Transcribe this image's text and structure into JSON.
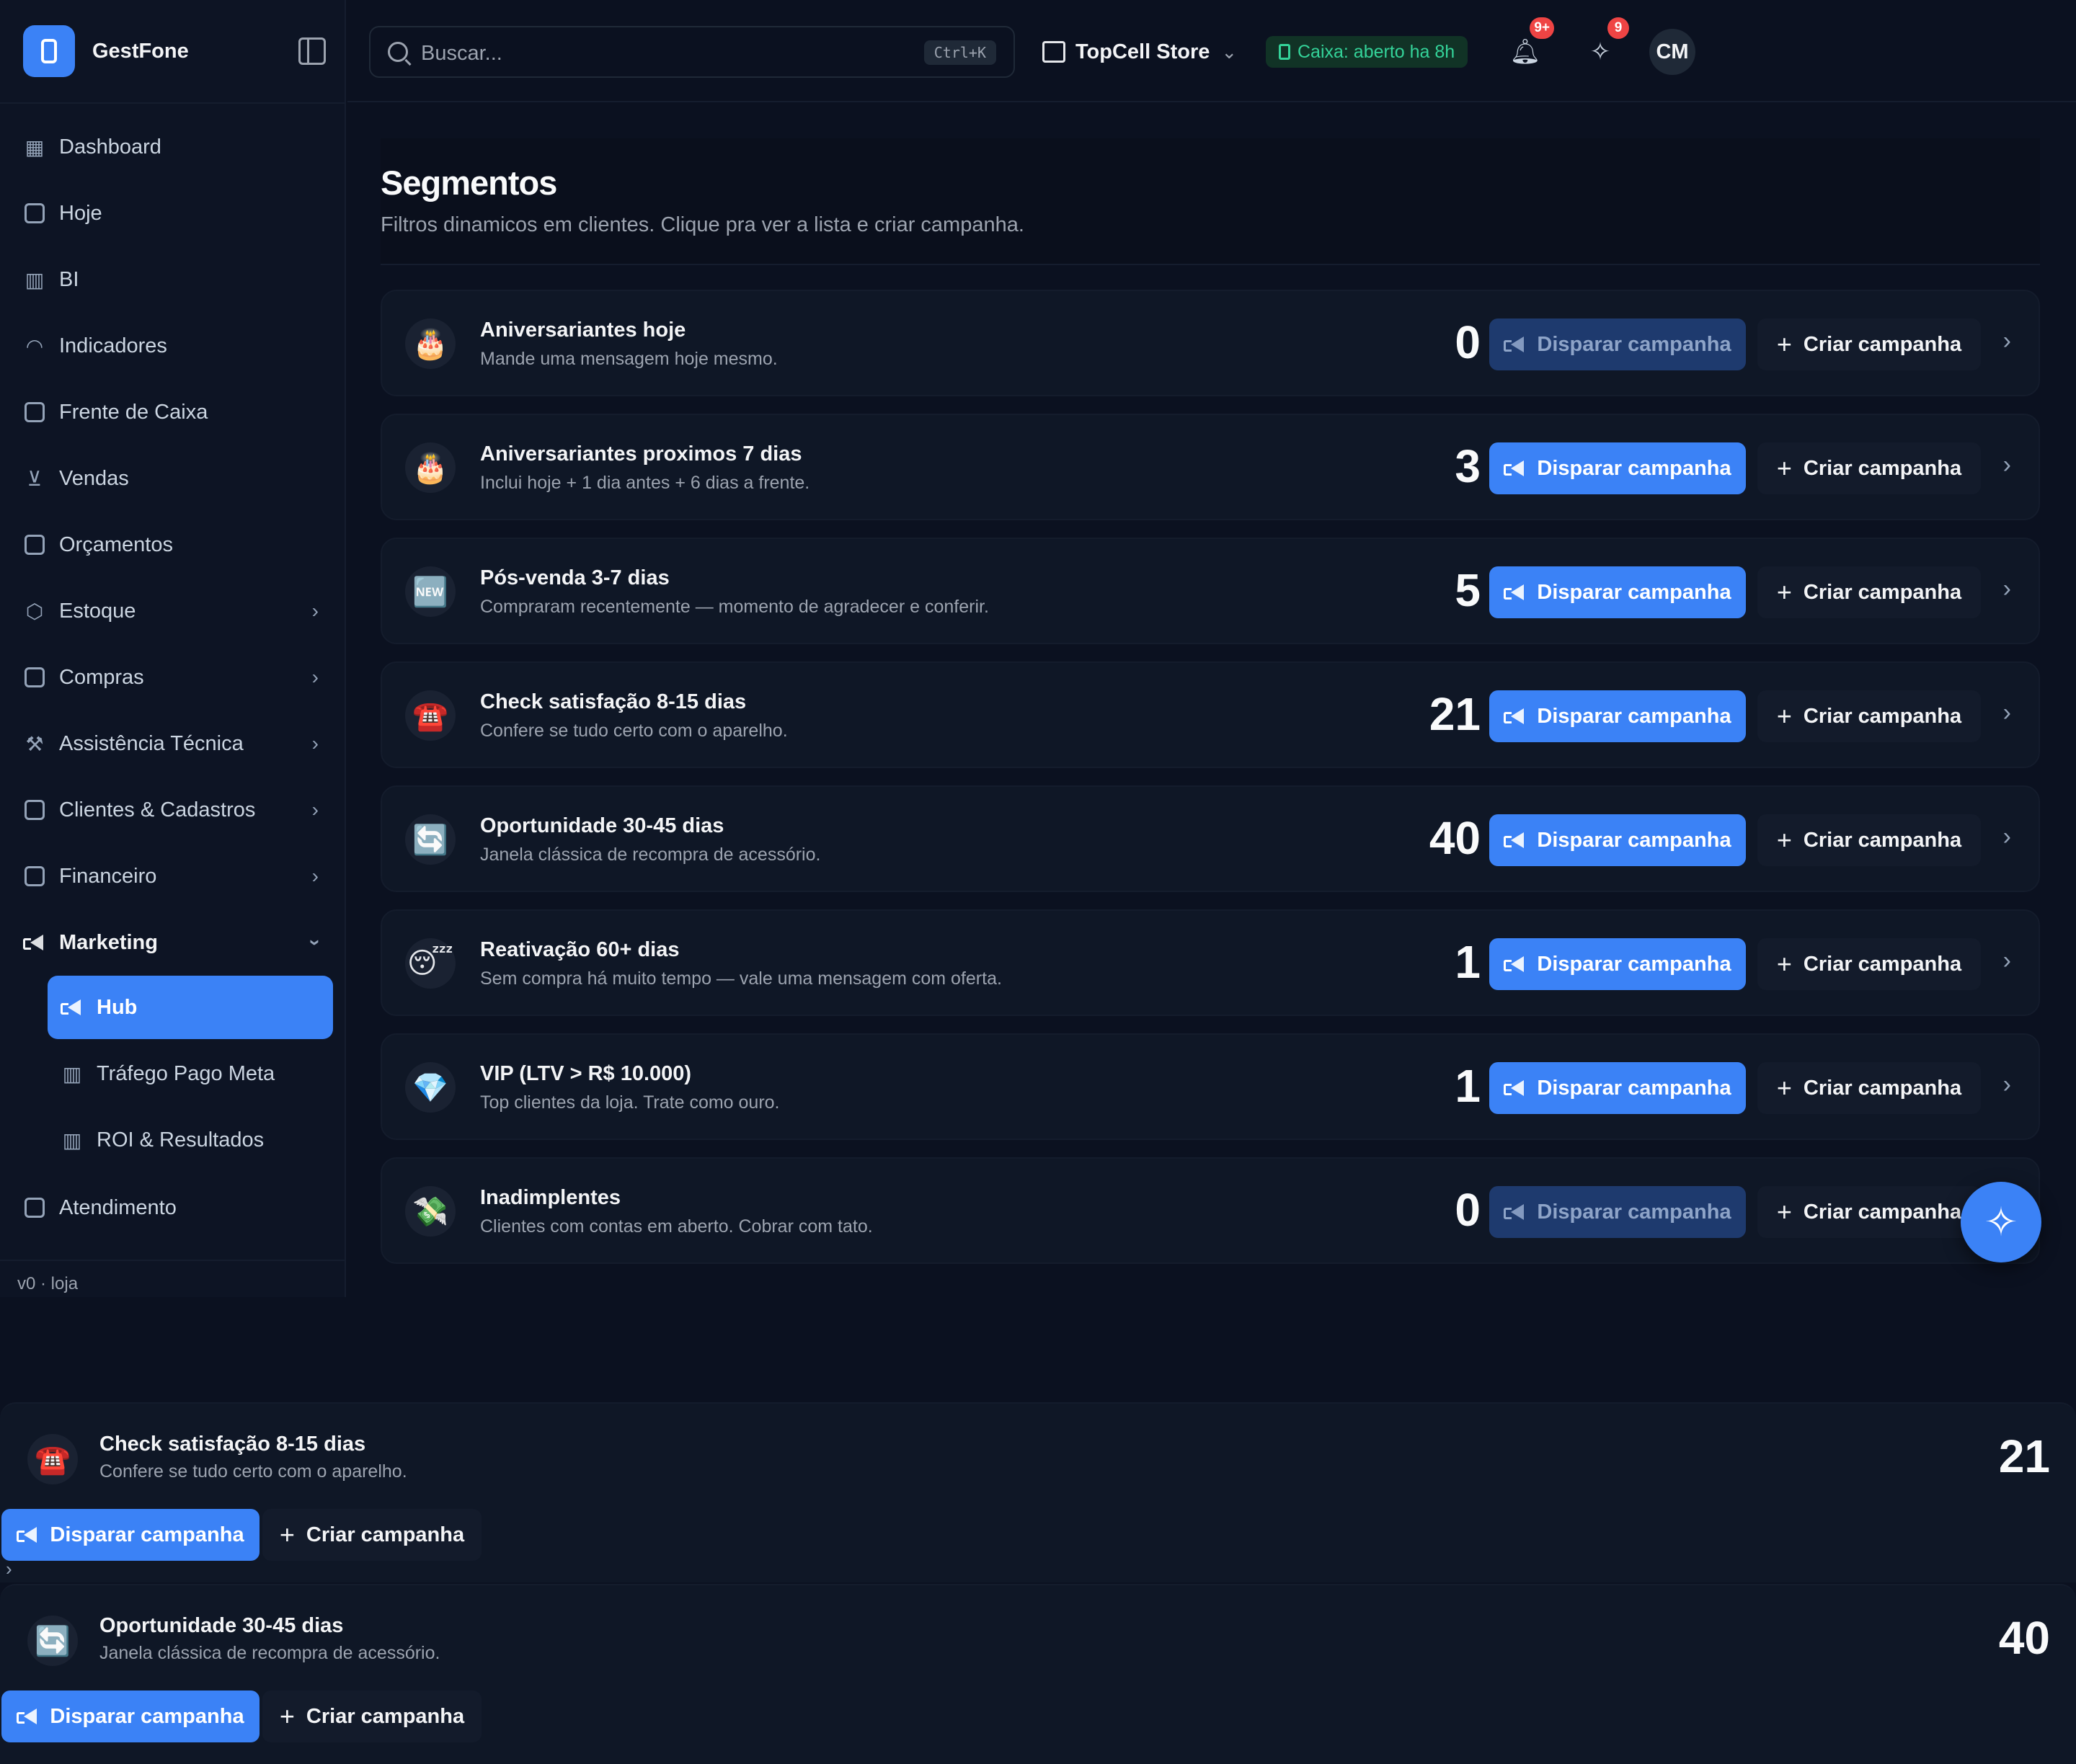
{
  "app": {
    "name": "GestFone",
    "version": "v0 · loja"
  },
  "topbar": {
    "search_placeholder": "Buscar...",
    "shortcut": "Ctrl+K",
    "store": "TopCell Store",
    "cash_status": "Caixa: aberto ha 8h",
    "notifications_badge": "9+",
    "ai_badge": "9",
    "avatar_initials": "CM"
  },
  "sidebar": {
    "items": [
      {
        "label": "Dashboard",
        "icon": "dashboard-icon"
      },
      {
        "label": "Hoje",
        "icon": "calendar-icon"
      },
      {
        "label": "BI",
        "icon": "bar-chart-icon"
      },
      {
        "label": "Indicadores",
        "icon": "gauge-icon"
      },
      {
        "label": "Frente de Caixa",
        "icon": "store-icon"
      },
      {
        "label": "Vendas",
        "icon": "cart-icon"
      },
      {
        "label": "Orçamentos",
        "icon": "document-icon"
      },
      {
        "label": "Estoque",
        "icon": "package-icon"
      },
      {
        "label": "Compras",
        "icon": "bag-icon"
      },
      {
        "label": "Assistência Técnica",
        "icon": "wrench-icon"
      },
      {
        "label": "Clientes & Cadastros",
        "icon": "contacts-icon"
      },
      {
        "label": "Financeiro",
        "icon": "wallet-icon"
      },
      {
        "label": "Marketing",
        "icon": "megaphone-icon"
      },
      {
        "label": "Atendimento",
        "icon": "chat-icon"
      }
    ],
    "marketing_sub": [
      {
        "label": "Hub",
        "icon": "megaphone-icon"
      },
      {
        "label": "Tráfego Pago Meta",
        "icon": "bar-chart-icon"
      },
      {
        "label": "ROI & Resultados",
        "icon": "bar-chart-icon"
      }
    ]
  },
  "page": {
    "title": "Segmentos",
    "subtitle": "Filtros dinamicos em clientes. Clique pra ver a lista e criar campanha."
  },
  "buttons": {
    "fire": "Disparar campanha",
    "create": "Criar campanha"
  },
  "segments": [
    {
      "emoji": "🎂",
      "title": "Aniversariantes hoje",
      "desc": "Mande uma mensagem hoje mesmo.",
      "count": "0",
      "enabled": false
    },
    {
      "emoji": "🎂",
      "title": "Aniversariantes proximos 7 dias",
      "desc": "Inclui hoje + 1 dia antes + 6 dias a frente.",
      "count": "3",
      "enabled": true
    },
    {
      "emoji": "🆕",
      "title": "Pós-venda 3-7 dias",
      "desc": "Compraram recentemente — momento de agradecer e conferir.",
      "count": "5",
      "enabled": true
    },
    {
      "emoji": "☎️",
      "title": "Check satisfação 8-15 dias",
      "desc": "Confere se tudo certo com o aparelho.",
      "count": "21",
      "enabled": true
    },
    {
      "emoji": "🔄",
      "title": "Oportunidade 30-45 dias",
      "desc": "Janela clássica de recompra de acessório.",
      "count": "40",
      "enabled": true
    },
    {
      "emoji": "😴",
      "title": "Reativação 60+ dias",
      "desc": "Sem compra há muito tempo — vale uma mensagem com oferta.",
      "count": "1",
      "enabled": true
    },
    {
      "emoji": "💎",
      "title": "VIP (LTV > R$ 10.000)",
      "desc": "Top clientes da loja. Trate como ouro.",
      "count": "1",
      "enabled": true
    },
    {
      "emoji": "💸",
      "title": "Inadimplentes",
      "desc": "Clientes com contas em aberto. Cobrar com tato.",
      "count": "0",
      "enabled": false
    }
  ],
  "mobile_cards": [
    {
      "emoji": "☎️",
      "title": "Check satisfação 8-15 dias",
      "desc": "Confere se tudo certo com o aparelho.",
      "count": "21"
    },
    {
      "emoji": "🔄",
      "title": "Oportunidade 30-45 dias",
      "desc": "Janela clássica de recompra de acessório.",
      "count": "40"
    }
  ],
  "colors": {
    "accent": "#3b82f6",
    "bg": "#0b1120",
    "cash_green": "#34d399",
    "badge_red": "#ef4444"
  }
}
